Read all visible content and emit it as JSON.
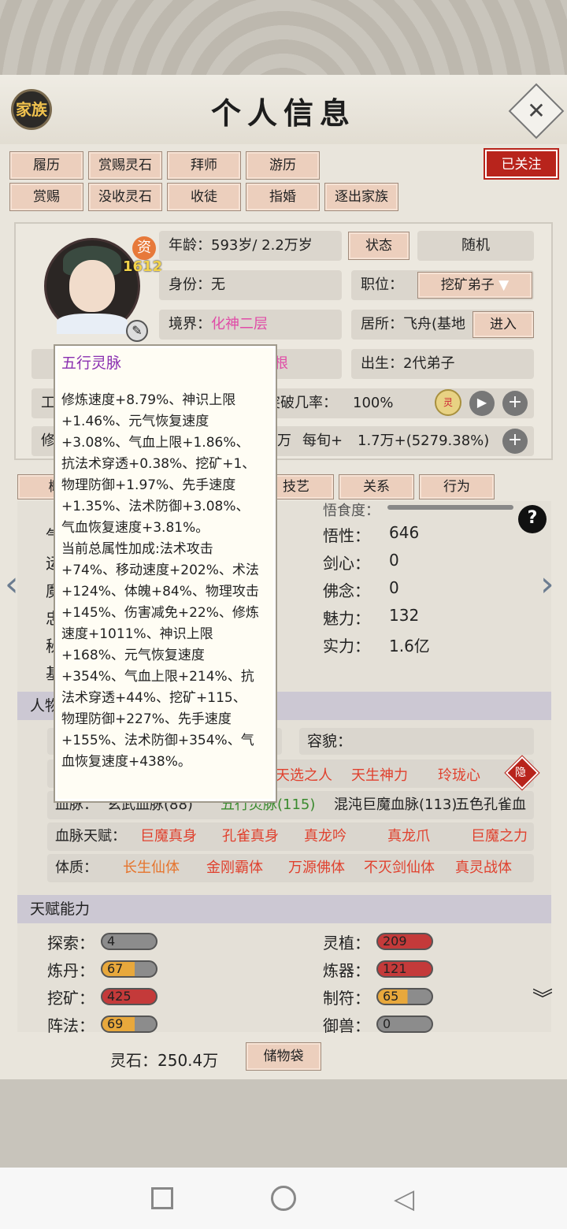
{
  "header": {
    "title": "个人信息",
    "family_label": "家族",
    "close_icon": "close-icon"
  },
  "follow_label": "已关注",
  "actions_row1": [
    "履历",
    "赏赐灵石",
    "拜师",
    "游历"
  ],
  "actions_row2": [
    "赏赐",
    "没收灵石",
    "收徒",
    "指婚",
    "逐出家族"
  ],
  "avatar": {
    "zi": "资",
    "value": "1612"
  },
  "age": {
    "label": "年龄：",
    "value": "593岁/ 2.2万岁"
  },
  "status_btn": "状态",
  "random_btn": "随机",
  "identity": {
    "label": "身份：",
    "value": "无"
  },
  "position": {
    "label": "职位：",
    "value": "挖矿弟子"
  },
  "realm": {
    "label": "境界：",
    "value": "化神二层"
  },
  "residence": {
    "label": "居所：",
    "value": "飞舟(基地"
  },
  "enter_btn": "进入",
  "root_frag": "根",
  "birth": {
    "label": "出生：",
    "value": "2代弟子"
  },
  "row5_left": "工",
  "breakthrough": {
    "label": "突破几率：",
    "value": "100%"
  },
  "row6_left": "修",
  "cultivation": {
    "frag": "万",
    "label": "每旬+",
    "value": "1.7万+(5279.38%)"
  },
  "tabs": [
    "概",
    "技艺",
    "关系",
    "行为"
  ],
  "stats": [
    {
      "label": "悟性：",
      "value": "646"
    },
    {
      "label": "剑心：",
      "value": "0"
    },
    {
      "label": "佛念：",
      "value": "0"
    },
    {
      "label": "魅力：",
      "value": "132"
    },
    {
      "label": "实力：",
      "value": "1.6亿"
    }
  ],
  "stats_top_frag": "悟食度：",
  "left_frags": [
    "气",
    "运",
    "魔",
    "忠",
    "秘",
    "基"
  ],
  "person_section": "人物",
  "appearance_label": "容貌：",
  "traits": [
    "天选之人",
    "天生神力",
    "玲珑心"
  ],
  "hide_label": "隐",
  "bloodline": {
    "label": "血脉：",
    "items": [
      "玄武血脉(88)",
      "五行灵脉(115)",
      "混沌巨魔血脉(113)",
      "五色孔雀血"
    ]
  },
  "bloodline_talent": {
    "label": "血脉天赋：",
    "items": [
      "巨魔真身",
      "孔雀真身",
      "真龙吟",
      "真龙爪",
      "巨魔之力"
    ]
  },
  "physique": {
    "label": "体质：",
    "items": [
      "长生仙体",
      "金刚霸体",
      "万源佛体",
      "不灭剑仙体",
      "真灵战体"
    ]
  },
  "talent_section": "天赋能力",
  "talents_left": [
    {
      "label": "探索：",
      "value": "4",
      "fill": 0.0
    },
    {
      "label": "炼丹：",
      "value": "67",
      "fill": 0.6
    },
    {
      "label": "挖矿：",
      "value": "425",
      "fill": 1.0
    },
    {
      "label": "阵法：",
      "value": "69",
      "fill": 0.6
    }
  ],
  "talents_right": [
    {
      "label": "灵植：",
      "value": "209",
      "fill": 1.0
    },
    {
      "label": "炼器：",
      "value": "121",
      "fill": 1.0
    },
    {
      "label": "制符：",
      "value": "65",
      "fill": 0.55
    },
    {
      "label": "御兽：",
      "value": "0",
      "fill": 0.0
    }
  ],
  "spirit_stone": {
    "label": "灵石：",
    "value": "250.4万"
  },
  "storage_btn": "储物袋",
  "tooltip": {
    "title": "五行灵脉",
    "body": "修炼速度+8.79%、神识上限\n+1.46%、元气恢复速度\n+3.08%、气血上限+1.86%、\n抗法术穿透+0.38%、挖矿+1、\n物理防御+1.97%、先手速度\n+1.35%、法术防御+3.08%、\n气血恢复速度+3.81%。\n当前总属性加成:法术攻击\n+74%、移动速度+202%、术法\n+124%、体魄+84%、物理攻击\n+145%、伤害减免+22%、修炼\n速度+1011%、神识上限\n+168%、元气恢复速度\n+354%、气血上限+214%、抗\n法术穿透+44%、挖矿+115、\n物理防御+227%、先手速度\n+155%、法术防御+354%、气\n血恢复速度+438%。"
  },
  "colors": {
    "pink": "#e04ca7",
    "red": "#e0412e",
    "orange": "#e6742c",
    "green": "#3a8a2e",
    "purple": "#8a2fb0"
  }
}
